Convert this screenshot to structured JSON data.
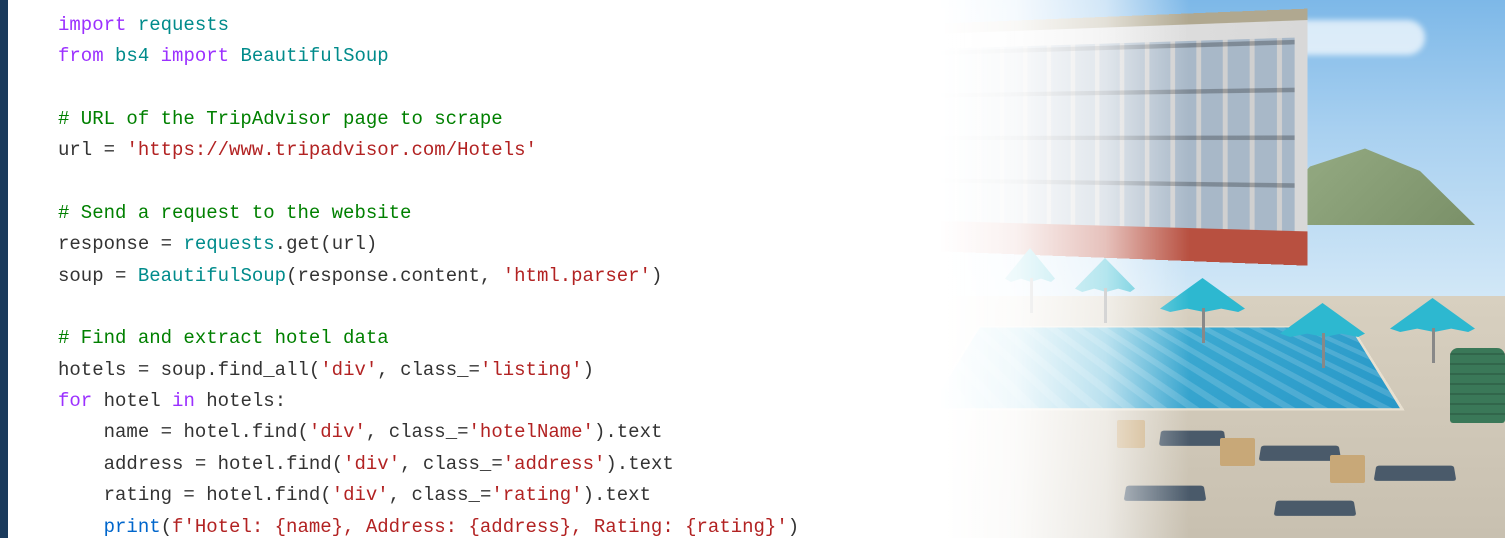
{
  "code": {
    "line1": {
      "kw1": "import",
      "mod1": "requests"
    },
    "line2": {
      "kw1": "from",
      "mod1": "bs4",
      "kw2": "import",
      "mod2": "BeautifulSoup"
    },
    "line3": "",
    "line4": {
      "com": "# URL of the TripAdvisor page to scrape"
    },
    "line5": {
      "var": "url",
      "op": " = ",
      "str": "'https://www.tripadvisor.com/Hotels'"
    },
    "line6": "",
    "line7": {
      "com": "# Send a request to the website"
    },
    "line8": {
      "var": "response",
      "op": " = ",
      "mod": "requests",
      "dot": ".",
      "fn": "get",
      "p1": "(",
      "arg": "url",
      "p2": ")"
    },
    "line9": {
      "var": "soup",
      "op": " = ",
      "mod": "BeautifulSoup",
      "p1": "(",
      "arg1": "response",
      "dot": ".",
      "arg2": "content",
      "comma": ", ",
      "str": "'html.parser'",
      "p2": ")"
    },
    "line10": "",
    "line11": {
      "com": "# Find and extract hotel data"
    },
    "line12": {
      "var": "hotels",
      "op": " = ",
      "obj": "soup",
      "dot": ".",
      "fn": "find_all",
      "p1": "(",
      "str1": "'div'",
      "comma": ", ",
      "param": "class_",
      "eq": "=",
      "str2": "'listing'",
      "p2": ")"
    },
    "line13": {
      "kw": "for",
      "var1": "hotel",
      "kw2": "in",
      "var2": "hotels",
      "colon": ":"
    },
    "line14": {
      "indent": "    ",
      "var": "name",
      "op": " = ",
      "obj": "hotel",
      "dot1": ".",
      "fn": "find",
      "p1": "(",
      "str1": "'div'",
      "comma": ", ",
      "param": "class_",
      "eq": "=",
      "str2": "'hotelName'",
      "p2": ")",
      "dot2": ".",
      "attr": "text"
    },
    "line15": {
      "indent": "    ",
      "var": "address",
      "op": " = ",
      "obj": "hotel",
      "dot1": ".",
      "fn": "find",
      "p1": "(",
      "str1": "'div'",
      "comma": ", ",
      "param": "class_",
      "eq": "=",
      "str2": "'address'",
      "p2": ")",
      "dot2": ".",
      "attr": "text"
    },
    "line16": {
      "indent": "    ",
      "var": "rating",
      "op": " = ",
      "obj": "hotel",
      "dot1": ".",
      "fn": "find",
      "p1": "(",
      "str1": "'div'",
      "comma": ", ",
      "param": "class_",
      "eq": "=",
      "str2": "'rating'",
      "p2": ")",
      "dot2": ".",
      "attr": "text"
    },
    "line17": {
      "indent": "    ",
      "fn": "print",
      "p1": "(",
      "fpre": "f",
      "str": "'Hotel: {name}, Address: {address}, Rating: {rating}'",
      "p2": ")"
    }
  }
}
